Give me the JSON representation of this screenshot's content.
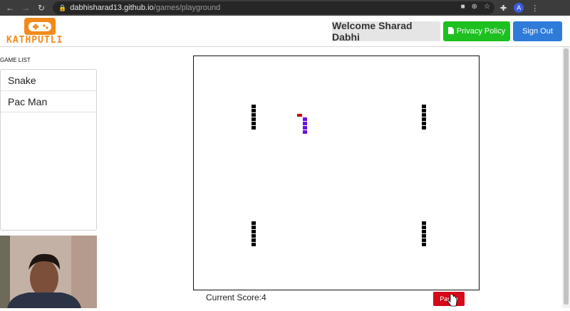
{
  "browser": {
    "url_host": "dabhisharad13.github.io",
    "url_path": "/games/playground",
    "avatar_letter": "A"
  },
  "header": {
    "logo_text": "KATHPUTLI",
    "welcome": "Welcome Sharad Dabhi",
    "privacy_label": "Privacy Policy",
    "signout_label": "Sign Out"
  },
  "sidebar": {
    "title": "GAME LIST",
    "games": [
      "Snake",
      "Pac Man"
    ]
  },
  "game": {
    "score_label": "Current Score:4",
    "pause_label": "Pause"
  },
  "colors": {
    "logo_orange": "#f28a1b",
    "privacy_green": "#1ec020",
    "signout_blue": "#2f7bd9",
    "pause_red": "#d4091a",
    "snake_purple": "#6a10e0",
    "food_red": "#d40000"
  }
}
